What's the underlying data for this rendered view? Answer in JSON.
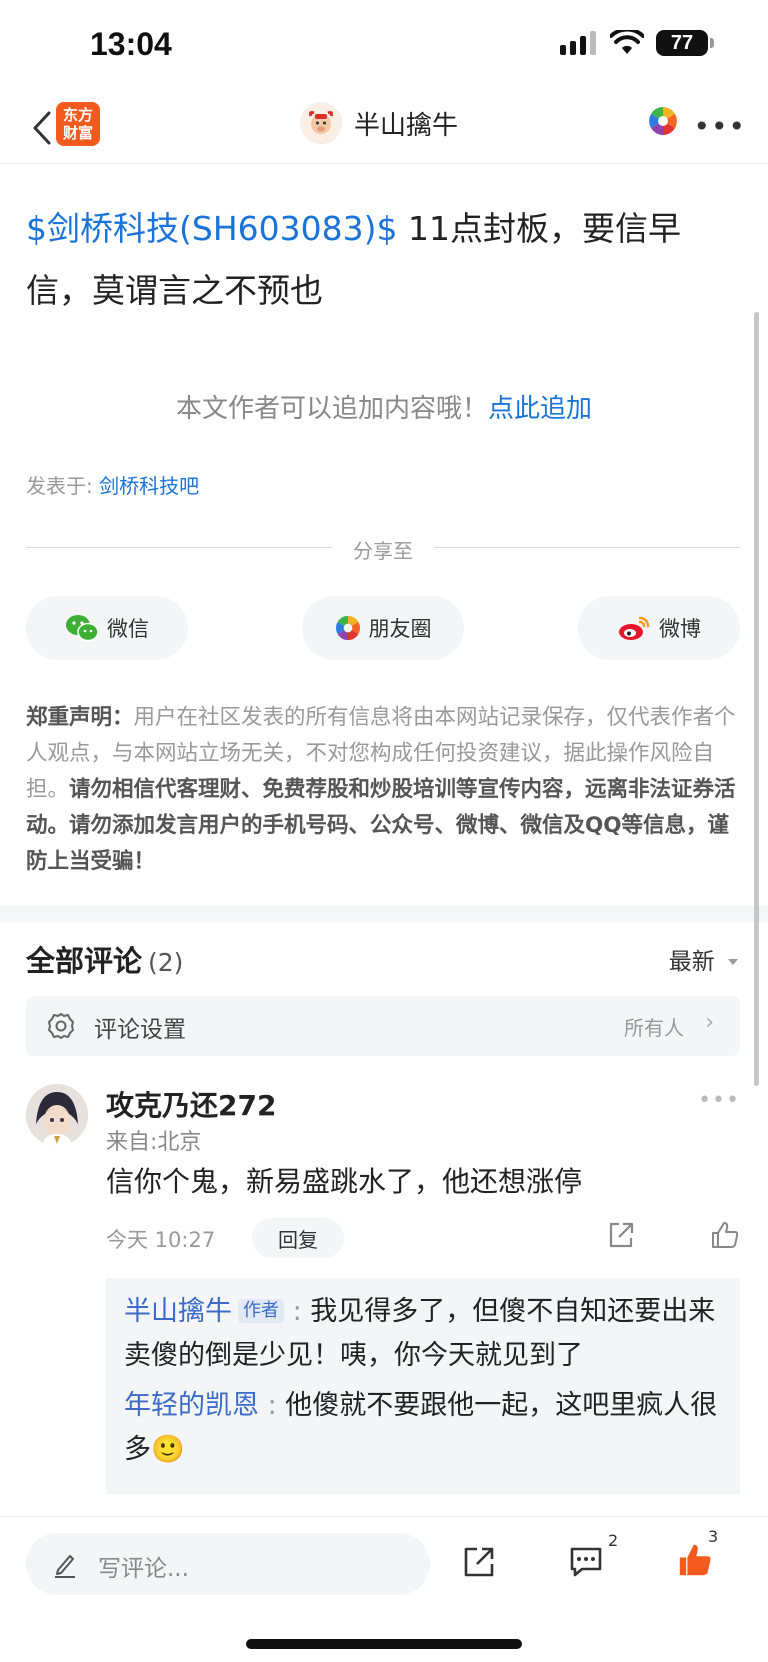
{
  "status": {
    "time": "13:04",
    "battery": "77"
  },
  "nav": {
    "logo_text": "东方财富",
    "title": "半山擒牛"
  },
  "post": {
    "stock_tag": "$剑桥科技(SH603083)$",
    "text": " 11点封板，要信早信，莫谓言之不预也"
  },
  "append": {
    "prompt": "本文作者可以追加内容哦！",
    "link": "点此追加"
  },
  "published": {
    "prefix": "发表于: ",
    "bar": "剑桥科技吧"
  },
  "share": {
    "label": "分享至",
    "wechat": "微信",
    "moments": "朋友圈",
    "weibo": "微博"
  },
  "disclaimer": {
    "title": "郑重声明：",
    "body": "用户在社区发表的所有信息将由本网站记录保存，仅代表作者个人观点，与本网站立场无关，不对您构成任何投资建议，据此操作风险自担。",
    "warning": "请勿相信代客理财、免费荐股和炒股培训等宣传内容，远离非法证券活动。请勿添加发言用户的手机号码、公众号、微博、微信及QQ等信息，谨防上当受骗！"
  },
  "comments": {
    "title": "全部评论",
    "count": "(2)",
    "sort": "最新",
    "settings_label": "评论设置",
    "settings_value": "所有人",
    "items": [
      {
        "user": "攻克乃还272",
        "location": "来自:北京",
        "text": "信你个鬼，新易盛跳水了，他还想涨停",
        "time": "今天 10:27",
        "reply_label": "回复",
        "replies": [
          {
            "user": "半山擒牛",
            "tag": "作者",
            "text": "我见得多了，但傻不自知还要出来卖傻的倒是少见！咦，你今天就见到了"
          },
          {
            "user": "年轻的凯恩",
            "text": "他傻就不要跟他一起，这吧里疯人很多🙂"
          }
        ]
      }
    ]
  },
  "bottom": {
    "placeholder": "写评论...",
    "comment_count": "2",
    "like_count": "3"
  },
  "colors": {
    "link": "#1a73d9",
    "brand": "#f25a1e",
    "like": "#f25a1e"
  }
}
